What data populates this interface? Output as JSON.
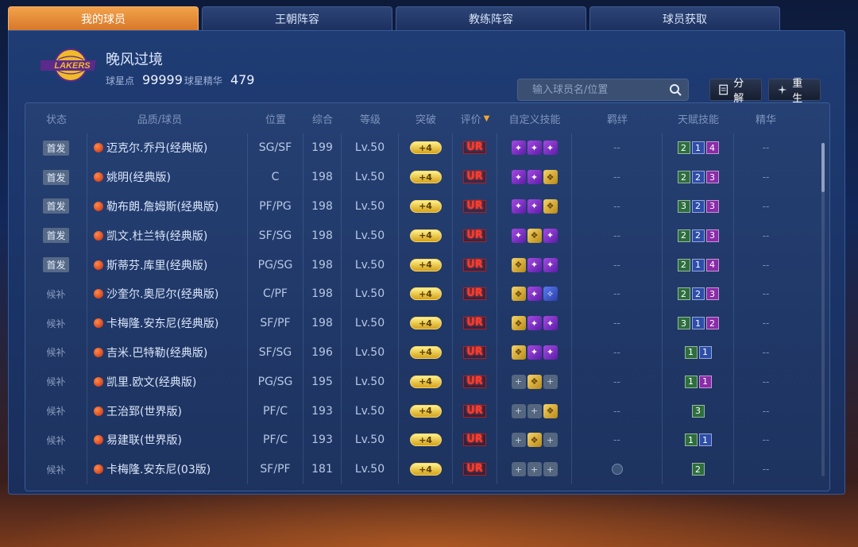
{
  "tabs": [
    {
      "label": "我的球员",
      "active": true
    },
    {
      "label": "王朝阵容",
      "active": false
    },
    {
      "label": "教练阵容",
      "active": false
    },
    {
      "label": "球员获取",
      "active": false
    }
  ],
  "header": {
    "team_name": "晚风过境",
    "star_points_label": "球星点",
    "star_points_value": "99999",
    "star_essence_label": "球星精华",
    "star_essence_value": "479",
    "logo_text": "LAKERS"
  },
  "search": {
    "placeholder": "输入球员名/位置"
  },
  "buttons": {
    "decompose": "分解",
    "rebirth": "重生"
  },
  "columns": {
    "status": "状态",
    "player": "品质/球员",
    "position": "位置",
    "overall": "综合",
    "level": "等级",
    "breakthrough": "突破",
    "rating": "评价",
    "skills": "自定义技能",
    "bond": "羁绊",
    "talent": "天赋技能",
    "essence": "精华"
  },
  "players": [
    {
      "status": "首发",
      "starter": true,
      "name": "迈克尔.乔丹(经典版)",
      "position": "SG/SF",
      "overall": "199",
      "level": "Lv.50",
      "breakthrough": "+4",
      "rating": "UR",
      "skills": [
        "purple",
        "purple",
        "purple"
      ],
      "bond": "--",
      "talent": [
        {
          "v": "2",
          "c": "green"
        },
        {
          "v": "1",
          "c": "blue"
        },
        {
          "v": "4",
          "c": "purple"
        }
      ],
      "essence": "--"
    },
    {
      "status": "首发",
      "starter": true,
      "name": "姚明(经典版)",
      "position": "C",
      "overall": "198",
      "level": "Lv.50",
      "breakthrough": "+4",
      "rating": "UR",
      "skills": [
        "purple",
        "purple",
        "gold"
      ],
      "bond": "--",
      "talent": [
        {
          "v": "2",
          "c": "green"
        },
        {
          "v": "2",
          "c": "blue"
        },
        {
          "v": "3",
          "c": "purple"
        }
      ],
      "essence": "--"
    },
    {
      "status": "首发",
      "starter": true,
      "name": "勒布朗.詹姆斯(经典版)",
      "position": "PF/PG",
      "overall": "198",
      "level": "Lv.50",
      "breakthrough": "+4",
      "rating": "UR",
      "skills": [
        "purple",
        "purple",
        "gold"
      ],
      "bond": "--",
      "talent": [
        {
          "v": "3",
          "c": "green"
        },
        {
          "v": "2",
          "c": "blue"
        },
        {
          "v": "3",
          "c": "purple"
        }
      ],
      "essence": "--"
    },
    {
      "status": "首发",
      "starter": true,
      "name": "凯文.杜兰特(经典版)",
      "position": "SF/SG",
      "overall": "198",
      "level": "Lv.50",
      "breakthrough": "+4",
      "rating": "UR",
      "skills": [
        "purple",
        "gold",
        "purple"
      ],
      "bond": "--",
      "talent": [
        {
          "v": "2",
          "c": "green"
        },
        {
          "v": "2",
          "c": "blue"
        },
        {
          "v": "3",
          "c": "purple"
        }
      ],
      "essence": "--"
    },
    {
      "status": "首发",
      "starter": true,
      "name": "斯蒂芬.库里(经典版)",
      "position": "PG/SG",
      "overall": "198",
      "level": "Lv.50",
      "breakthrough": "+4",
      "rating": "UR",
      "skills": [
        "gold",
        "purple",
        "purple"
      ],
      "bond": "--",
      "talent": [
        {
          "v": "2",
          "c": "green"
        },
        {
          "v": "1",
          "c": "blue"
        },
        {
          "v": "4",
          "c": "purple"
        }
      ],
      "essence": "--"
    },
    {
      "status": "候补",
      "starter": false,
      "name": "沙奎尔.奥尼尔(经典版)",
      "position": "C/PF",
      "overall": "198",
      "level": "Lv.50",
      "breakthrough": "+4",
      "rating": "UR",
      "skills": [
        "gold",
        "purple",
        "blue"
      ],
      "bond": "--",
      "talent": [
        {
          "v": "2",
          "c": "green"
        },
        {
          "v": "2",
          "c": "blue"
        },
        {
          "v": "3",
          "c": "purple"
        }
      ],
      "essence": "--"
    },
    {
      "status": "候补",
      "starter": false,
      "name": "卡梅隆.安东尼(经典版)",
      "position": "SF/PF",
      "overall": "198",
      "level": "Lv.50",
      "breakthrough": "+4",
      "rating": "UR",
      "skills": [
        "gold",
        "purple",
        "purple"
      ],
      "bond": "--",
      "talent": [
        {
          "v": "3",
          "c": "green"
        },
        {
          "v": "1",
          "c": "blue"
        },
        {
          "v": "2",
          "c": "purple"
        }
      ],
      "essence": "--"
    },
    {
      "status": "候补",
      "starter": false,
      "name": "吉米.巴特勒(经典版)",
      "position": "SF/SG",
      "overall": "196",
      "level": "Lv.50",
      "breakthrough": "+4",
      "rating": "UR",
      "skills": [
        "gold",
        "purple",
        "purple"
      ],
      "bond": "--",
      "talent": [
        {
          "v": "1",
          "c": "green"
        },
        {
          "v": "1",
          "c": "blue"
        }
      ],
      "essence": "--"
    },
    {
      "status": "候补",
      "starter": false,
      "name": "凯里.欧文(经典版)",
      "position": "PG/SG",
      "overall": "195",
      "level": "Lv.50",
      "breakthrough": "+4",
      "rating": "UR",
      "skills": [
        "empty",
        "gold",
        "empty"
      ],
      "bond": "--",
      "talent": [
        {
          "v": "1",
          "c": "green"
        },
        {
          "v": "1",
          "c": "purple"
        }
      ],
      "essence": "--"
    },
    {
      "status": "候补",
      "starter": false,
      "name": "王治郅(世界版)",
      "position": "PF/C",
      "overall": "193",
      "level": "Lv.50",
      "breakthrough": "+4",
      "rating": "UR",
      "skills": [
        "empty",
        "empty",
        "gold"
      ],
      "bond": "--",
      "talent": [
        {
          "v": "3",
          "c": "green"
        }
      ],
      "essence": "--"
    },
    {
      "status": "候补",
      "starter": false,
      "name": "易建联(世界版)",
      "position": "PF/C",
      "overall": "193",
      "level": "Lv.50",
      "breakthrough": "+4",
      "rating": "UR",
      "skills": [
        "empty",
        "gold",
        "empty"
      ],
      "bond": "--",
      "talent": [
        {
          "v": "1",
          "c": "green"
        },
        {
          "v": "1",
          "c": "blue"
        }
      ],
      "essence": "--"
    },
    {
      "status": "候补",
      "starter": false,
      "name": "卡梅隆.安东尼(03版)",
      "position": "SF/PF",
      "overall": "181",
      "level": "Lv.50",
      "breakthrough": "+4",
      "rating": "UR",
      "skills": [
        "empty",
        "empty",
        "empty"
      ],
      "bond": "icon",
      "talent": [
        {
          "v": "2",
          "c": "green"
        }
      ],
      "essence": "--"
    }
  ]
}
